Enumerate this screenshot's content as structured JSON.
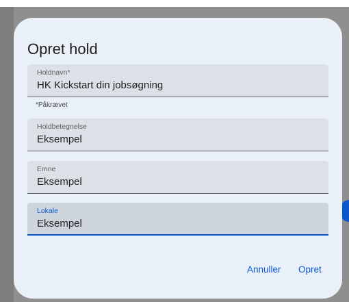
{
  "dialog": {
    "title": "Opret hold",
    "fields": [
      {
        "label": "Holdnavn*",
        "value": "HK Kickstart din jobsøgning"
      },
      {
        "label": "Holdbetegnelse",
        "value": "Eksempel"
      },
      {
        "label": "Emne",
        "value": "Eksempel"
      },
      {
        "label": "Lokale",
        "value": "Eksempel"
      }
    ],
    "helper_text": "*Påkrævet",
    "cancel_label": "Annuller",
    "create_label": "Opret"
  },
  "colors": {
    "accent": "#0b57d0",
    "dialog_background": "#eaf0f8",
    "field_background": "#dce1e7"
  }
}
